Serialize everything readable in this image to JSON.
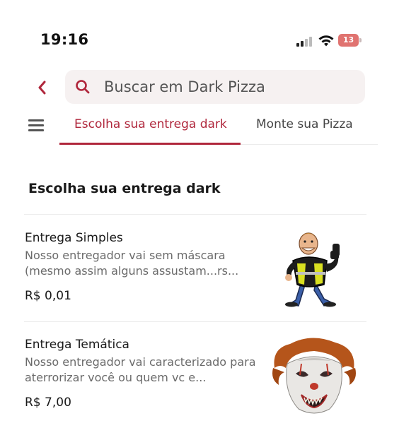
{
  "status_bar": {
    "time": "19:16",
    "battery": "13",
    "battery_color": "#e07370"
  },
  "header": {
    "back_icon": "chevron-left-icon",
    "search": {
      "icon": "search-icon",
      "placeholder": "Buscar em Dark Pizza"
    }
  },
  "nav": {
    "menu_icon": "hamburger-menu-icon",
    "tabs": [
      {
        "label": "Escolha sua entrega dark",
        "active": true
      },
      {
        "label": "Monte sua Pizza",
        "active": false
      }
    ],
    "accent_color": "#b0273c"
  },
  "section": {
    "title": "Escolha sua entrega dark",
    "items": [
      {
        "name": "Entrega Simples",
        "description": "Nosso entregador vai sem máscara (mesmo assim alguns assustam...rs...",
        "price": "R$ 0,01",
        "image": "delivery-man-thumbs-up-image"
      },
      {
        "name": "Entrega Temática",
        "description": "Nosso entregador vai caracterizado para aterrorizar você ou quem vc e...",
        "price": "R$ 7,00",
        "image": "clown-mask-image"
      }
    ]
  }
}
